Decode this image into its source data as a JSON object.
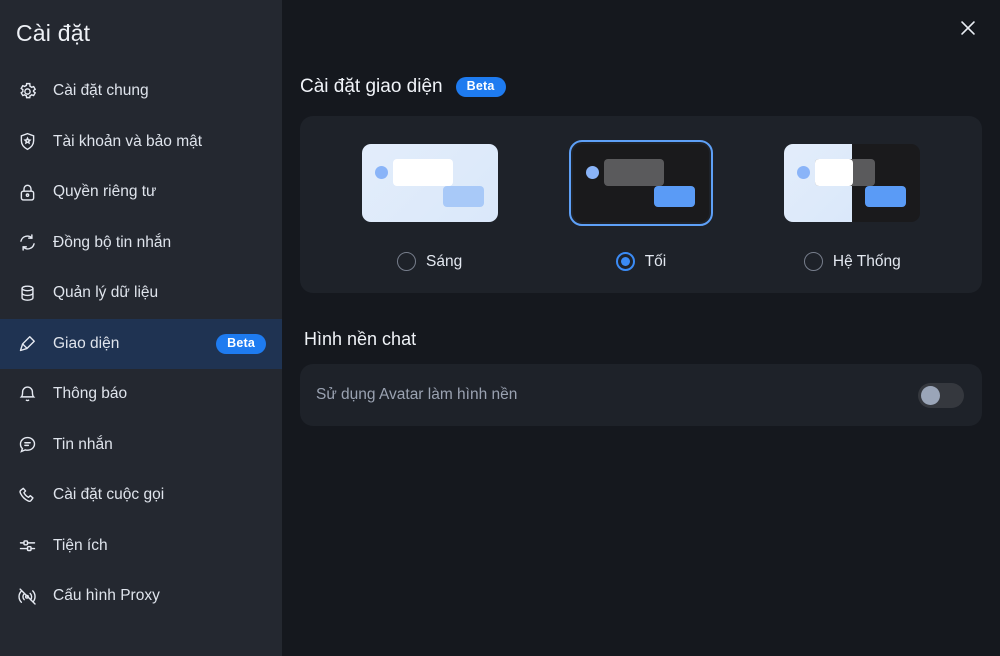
{
  "sidebar": {
    "title": "Cài đặt",
    "items": [
      {
        "label": "Cài đặt chung",
        "icon": "gear-icon",
        "active": false,
        "badge": null
      },
      {
        "label": "Tài khoản và bảo mật",
        "icon": "shield-star-icon",
        "active": false,
        "badge": null
      },
      {
        "label": "Quyền riêng tư",
        "icon": "lock-icon",
        "active": false,
        "badge": null
      },
      {
        "label": "Đồng bộ tin nhắn",
        "icon": "sync-icon",
        "active": false,
        "badge": null
      },
      {
        "label": "Quản lý dữ liệu",
        "icon": "database-icon",
        "active": false,
        "badge": null
      },
      {
        "label": "Giao diện",
        "icon": "palette-icon",
        "active": true,
        "badge": "Beta"
      },
      {
        "label": "Thông báo",
        "icon": "bell-icon",
        "active": false,
        "badge": null
      },
      {
        "label": "Tin nhắn",
        "icon": "chat-icon",
        "active": false,
        "badge": null
      },
      {
        "label": "Cài đặt cuộc gọi",
        "icon": "phone-icon",
        "active": false,
        "badge": null
      },
      {
        "label": "Tiện ích",
        "icon": "sliders-icon",
        "active": false,
        "badge": null
      },
      {
        "label": "Cấu hình Proxy",
        "icon": "proxy-off-icon",
        "active": false,
        "badge": null
      }
    ]
  },
  "main": {
    "close_icon": "close-icon",
    "appearance": {
      "title": "Cài đặt giao diện",
      "badge": "Beta",
      "themes": [
        {
          "id": "light",
          "label": "Sáng",
          "selected": false
        },
        {
          "id": "dark",
          "label": "Tối",
          "selected": true
        },
        {
          "id": "system",
          "label": "Hệ Thống",
          "selected": false
        }
      ]
    },
    "chat_background": {
      "title": "Hình nền chat",
      "option_label": "Sử dụng Avatar làm hình nền",
      "toggle_state": "off"
    }
  },
  "colors": {
    "accent": "#1e7bf0",
    "sidebar_bg": "#242830",
    "main_bg": "#15181e",
    "panel_bg": "#1e2229",
    "active_row_bg": "#1f3352",
    "radio_selected": "#3b8bf5"
  }
}
